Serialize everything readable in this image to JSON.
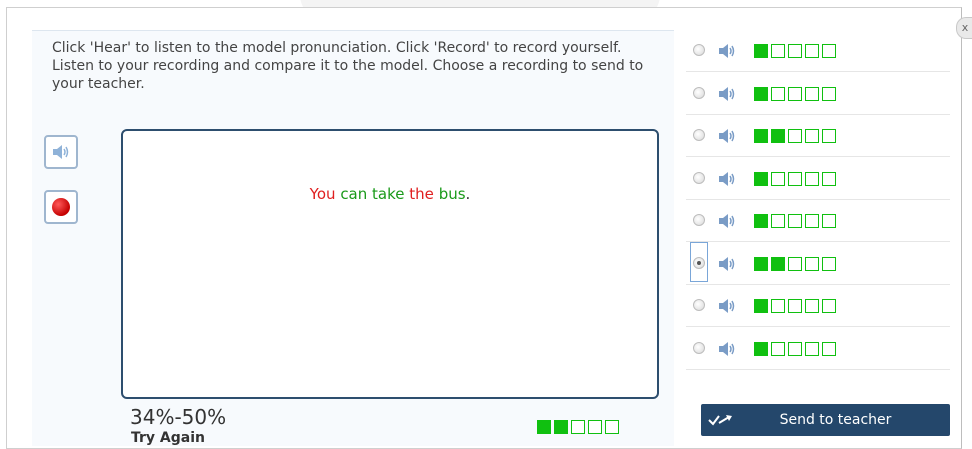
{
  "close_label": "x",
  "instructions": "Click 'Hear' to listen to the model pronunciation. Click 'Record' to record yourself. Listen to your recording and compare it to the model. Choose a recording to send to your teacher.",
  "tools": {
    "hear_icon": "speaker-icon",
    "record_icon": "record-icon"
  },
  "sentence": {
    "words": [
      {
        "text": "You",
        "color": "#e02020"
      },
      {
        "text": "can",
        "color": "#1a9a1a"
      },
      {
        "text": "take",
        "color": "#1a9a1a"
      },
      {
        "text": "the",
        "color": "#e02020"
      },
      {
        "text": "bus",
        "color": "#1a9a1a"
      }
    ],
    "end": "."
  },
  "result": {
    "score_range": "34%-50%",
    "feedback": "Try Again",
    "level": 2,
    "max_level": 5
  },
  "recordings": [
    {
      "selected": false,
      "level": 1
    },
    {
      "selected": false,
      "level": 1
    },
    {
      "selected": false,
      "level": 2
    },
    {
      "selected": false,
      "level": 1
    },
    {
      "selected": false,
      "level": 1
    },
    {
      "selected": true,
      "level": 2
    },
    {
      "selected": false,
      "level": 1
    },
    {
      "selected": false,
      "level": 1
    }
  ],
  "send_button": {
    "label": "Send to teacher",
    "icon": "send-arrow-icon"
  },
  "colors": {
    "accent": "#24476b",
    "meter_green": "#10c010",
    "box_border": "#2d4e6e"
  }
}
